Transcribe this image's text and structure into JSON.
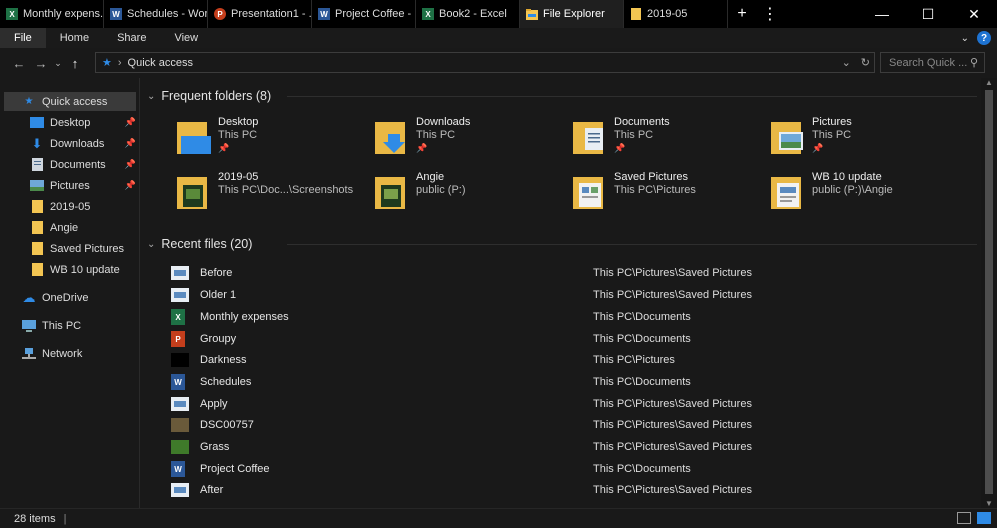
{
  "tabs": [
    {
      "label": "Monthly expens...",
      "app": "excel",
      "active": false
    },
    {
      "label": "Schedules - Word",
      "app": "word",
      "active": false
    },
    {
      "label": "Presentation1 - ...",
      "app": "powerpoint",
      "active": false
    },
    {
      "label": "Project Coffee - ...",
      "app": "word",
      "active": false
    },
    {
      "label": "Book2 - Excel",
      "app": "excel",
      "active": false
    },
    {
      "label": "File Explorer",
      "app": "explorer",
      "active": true
    },
    {
      "label": "2019-05",
      "app": "folder",
      "active": false
    }
  ],
  "window": {
    "new_tab": "+",
    "more": "⋮",
    "minimize": "—",
    "maximize": "☐",
    "close": "✕"
  },
  "ribbon": {
    "file": "File",
    "home": "Home",
    "share": "Share",
    "view": "View",
    "help": "?"
  },
  "address": {
    "path": "Quick access",
    "search_placeholder": "Search Quick ..."
  },
  "nav_pane": {
    "quick_access": "Quick access",
    "items": [
      {
        "label": "Desktop",
        "pinned": true
      },
      {
        "label": "Downloads",
        "pinned": true
      },
      {
        "label": "Documents",
        "pinned": true
      },
      {
        "label": "Pictures",
        "pinned": true
      },
      {
        "label": "2019-05",
        "pinned": false
      },
      {
        "label": "Angie",
        "pinned": false
      },
      {
        "label": "Saved Pictures",
        "pinned": false
      },
      {
        "label": "WB 10 update",
        "pinned": false
      }
    ],
    "onedrive": "OneDrive",
    "this_pc": "This PC",
    "network": "Network"
  },
  "frequent": {
    "header": "Frequent folders (8)",
    "folders": [
      {
        "name": "Desktop",
        "location": "This PC",
        "pinned": true
      },
      {
        "name": "Downloads",
        "location": "This PC",
        "pinned": true
      },
      {
        "name": "Documents",
        "location": "This PC",
        "pinned": true
      },
      {
        "name": "Pictures",
        "location": "This PC",
        "pinned": true
      },
      {
        "name": "2019-05",
        "location": "This PC\\Doc...\\Screenshots",
        "pinned": false
      },
      {
        "name": "Angie",
        "location": "public (P:)",
        "pinned": false
      },
      {
        "name": "Saved Pictures",
        "location": "This PC\\Pictures",
        "pinned": false
      },
      {
        "name": "WB 10 update",
        "location": "public (P:)\\Angie",
        "pinned": false
      }
    ]
  },
  "recent": {
    "header": "Recent files (20)",
    "files": [
      {
        "name": "Before",
        "location": "This PC\\Pictures\\Saved Pictures",
        "type": "image"
      },
      {
        "name": "Older 1",
        "location": "This PC\\Pictures\\Saved Pictures",
        "type": "image"
      },
      {
        "name": "Monthly expenses",
        "location": "This PC\\Documents",
        "type": "excel"
      },
      {
        "name": "Groupy",
        "location": "This PC\\Documents",
        "type": "powerpoint"
      },
      {
        "name": "Darkness",
        "location": "This PC\\Pictures",
        "type": "dark-image"
      },
      {
        "name": "Schedules",
        "location": "This PC\\Documents",
        "type": "word"
      },
      {
        "name": "Apply",
        "location": "This PC\\Pictures\\Saved Pictures",
        "type": "image"
      },
      {
        "name": "DSC00757",
        "location": "This PC\\Pictures\\Saved Pictures",
        "type": "photo"
      },
      {
        "name": "Grass",
        "location": "This PC\\Pictures\\Saved Pictures",
        "type": "photo-green"
      },
      {
        "name": "Project Coffee",
        "location": "This PC\\Documents",
        "type": "word"
      },
      {
        "name": "After",
        "location": "This PC\\Pictures\\Saved Pictures",
        "type": "image"
      }
    ]
  },
  "status": {
    "items_count": "28 items",
    "separator": "|"
  },
  "colors": {
    "accent": "#2f8be6",
    "folder": "#f3c552",
    "excel": "#1e7145",
    "word": "#2b5797",
    "powerpoint": "#c43e1c"
  }
}
